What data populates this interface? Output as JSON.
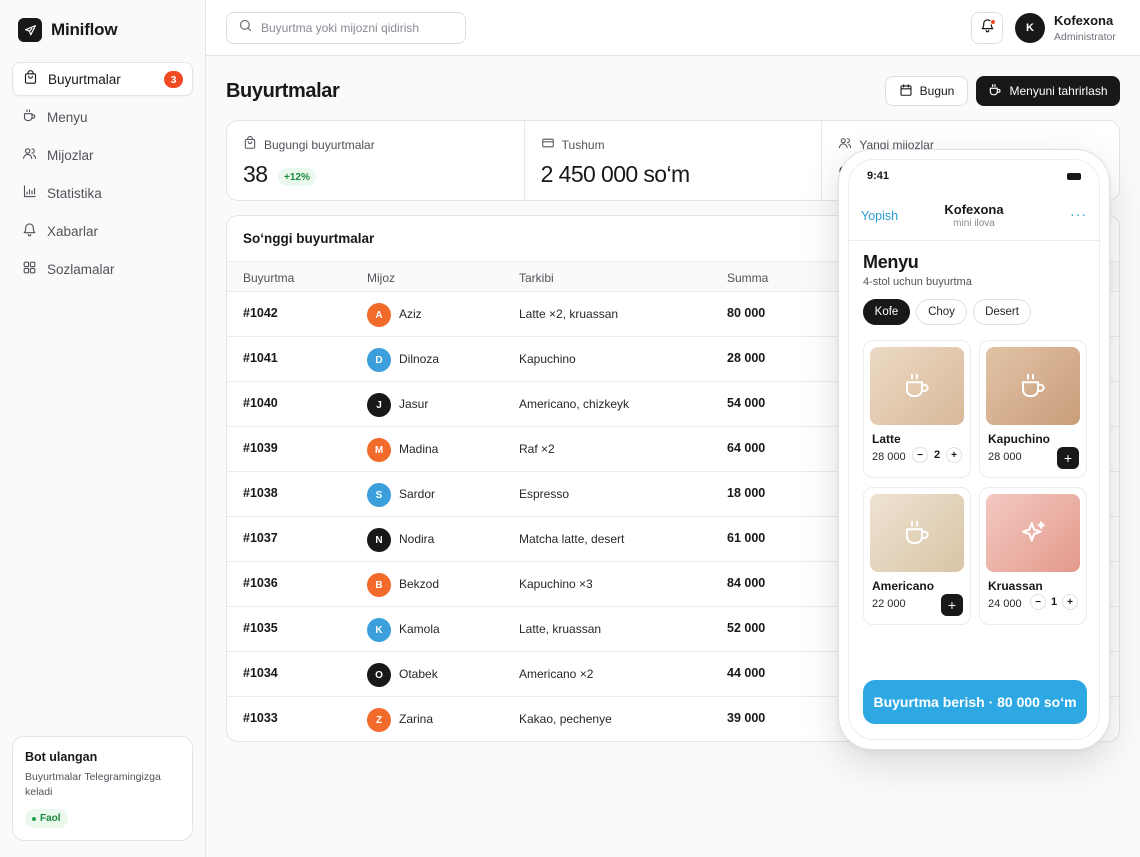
{
  "brand": {
    "name": "Miniflow"
  },
  "sidebar": {
    "items": [
      {
        "label": "Buyurtmalar",
        "icon": "shopping-bag-icon",
        "active": true,
        "badge": "3"
      },
      {
        "label": "Menyu",
        "icon": "coffee-cup-icon"
      },
      {
        "label": "Mijozlar",
        "icon": "users-icon"
      },
      {
        "label": "Statistika",
        "icon": "chart-icon"
      },
      {
        "label": "Xabarlar",
        "icon": "bell-icon"
      },
      {
        "label": "Sozlamalar",
        "icon": "grid-icon"
      }
    ],
    "bot": {
      "title": "Bot ulangan",
      "desc": "Buyurtmalar Telegramingizga keladi",
      "status": "Faol"
    }
  },
  "topbar": {
    "search_placeholder": "Buyurtma yoki mijozni qidirish",
    "user": {
      "initial": "K",
      "name": "Kofexona",
      "role": "Administrator"
    }
  },
  "header": {
    "title": "Buyurtmalar",
    "today_label": "Bugun",
    "edit_menu_label": "Menyuni tahrirlash"
  },
  "stats": [
    {
      "label": "Bugungi buyurtmalar",
      "value": "38",
      "delta": "+12%"
    },
    {
      "label": "Tushum",
      "value": "2 450 000 so‘m"
    },
    {
      "label": "Yangi mijozlar",
      "value": "9"
    }
  ],
  "orders": {
    "title": "So‘nggi buyurtmalar",
    "columns": [
      "Buyurtma",
      "Mijoz",
      "Tarkibi",
      "Summa"
    ],
    "rows": [
      {
        "id": "#1042",
        "initial": "A",
        "name": "Aziz",
        "items": "Latte ×2, kruassan",
        "sum": "80 000",
        "color": "#f26b2a"
      },
      {
        "id": "#1041",
        "initial": "D",
        "name": "Dilnoza",
        "items": "Kapuchino",
        "sum": "28 000",
        "color": "#3a9fdb"
      },
      {
        "id": "#1040",
        "initial": "J",
        "name": "Jasur",
        "items": "Americano, chizkeyk",
        "sum": "54 000",
        "color": "#18181b"
      },
      {
        "id": "#1039",
        "initial": "M",
        "name": "Madina",
        "items": "Raf ×2",
        "sum": "64 000",
        "color": "#f26b2a"
      },
      {
        "id": "#1038",
        "initial": "S",
        "name": "Sardor",
        "items": "Espresso",
        "sum": "18 000",
        "color": "#3a9fdb"
      },
      {
        "id": "#1037",
        "initial": "N",
        "name": "Nodira",
        "items": "Matcha latte, desert",
        "sum": "61 000",
        "color": "#18181b"
      },
      {
        "id": "#1036",
        "initial": "B",
        "name": "Bekzod",
        "items": "Kapuchino ×3",
        "sum": "84 000",
        "color": "#f26b2a"
      },
      {
        "id": "#1035",
        "initial": "K",
        "name": "Kamola",
        "items": "Latte, kruassan",
        "sum": "52 000",
        "color": "#3a9fdb"
      },
      {
        "id": "#1034",
        "initial": "O",
        "name": "Otabek",
        "items": "Americano ×2",
        "sum": "44 000",
        "color": "#18181b"
      },
      {
        "id": "#1033",
        "initial": "Z",
        "name": "Zarina",
        "items": "Kakao, pechenye",
        "sum": "39 000",
        "color": "#f26b2a"
      }
    ]
  },
  "phone": {
    "time": "9:41",
    "close_label": "Yopish",
    "title": "Kofexona",
    "subtitle": "mini ilova",
    "more": "···",
    "menu_title": "Menyu",
    "menu_sub": "4-stol uchun buyurtma",
    "chips": [
      "Kofe",
      "Choy",
      "Desert"
    ],
    "products": [
      {
        "name": "Latte",
        "price": "28 000",
        "qty": "2",
        "icon": "coffee-cup-icon"
      },
      {
        "name": "Kapuchino",
        "price": "28 000",
        "icon": "coffee-cup-icon"
      },
      {
        "name": "Americano",
        "price": "22 000",
        "icon": "coffee-cup-icon"
      },
      {
        "name": "Kruassan",
        "price": "24 000",
        "qty": "1",
        "icon": "sparkle-icon"
      }
    ],
    "cta": "Buyurtma berish · 80 000 so‘m",
    "accent": "#2ea8e3"
  }
}
